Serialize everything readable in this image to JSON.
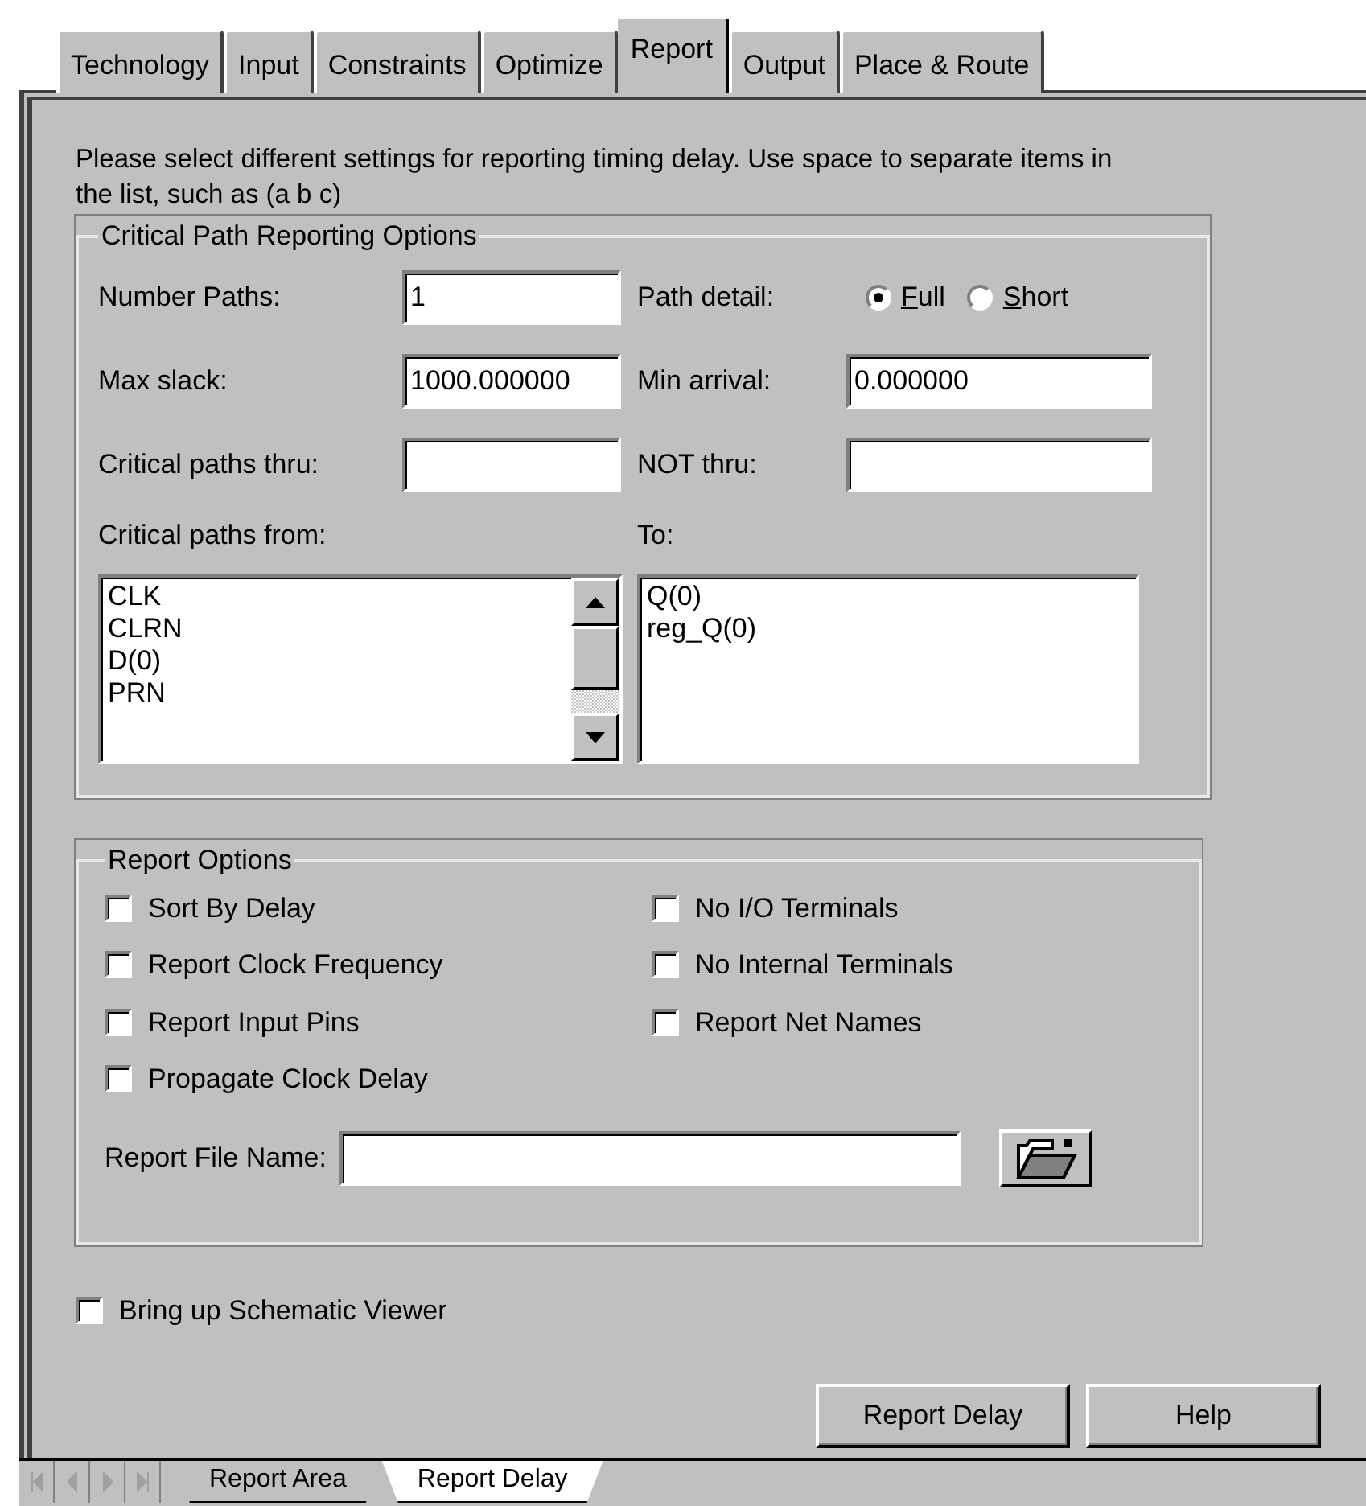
{
  "tabs": [
    {
      "label": "Technology",
      "selected": false
    },
    {
      "label": "Input",
      "selected": false
    },
    {
      "label": "Constraints",
      "selected": false
    },
    {
      "label": "Optimize",
      "selected": false
    },
    {
      "label": "Report",
      "selected": true
    },
    {
      "label": "Output",
      "selected": false
    },
    {
      "label": "Place & Route",
      "selected": false
    }
  ],
  "intro": "Please select different settings for reporting timing delay.  Use space to separate items in the list, such as (a b c)",
  "critical_path": {
    "title": "Critical Path Reporting Options",
    "number_paths": {
      "label": "Number Paths:",
      "value": "1"
    },
    "path_detail": {
      "label": "Path detail:",
      "options": [
        {
          "label": "Full",
          "selected": true
        },
        {
          "label": "Short",
          "selected": false
        }
      ]
    },
    "max_slack": {
      "label": "Max slack:",
      "value": "1000.000000"
    },
    "min_arrival": {
      "label": "Min arrival:",
      "value": "0.000000"
    },
    "thru": {
      "label": "Critical paths thru:"
    },
    "not_thru": {
      "label": "NOT thru:"
    },
    "from": {
      "label": "Critical paths from:",
      "items": [
        "CLK",
        "CLRN",
        "D(0)",
        "PRN"
      ]
    },
    "to": {
      "label": "To:",
      "items": [
        "Q(0)",
        "reg_Q(0)"
      ]
    }
  },
  "report_options": {
    "title": "Report Options",
    "left": [
      {
        "label": "Sort By Delay",
        "checked": false
      },
      {
        "label": "Report Clock Frequency",
        "checked": false
      },
      {
        "label": "Report Input Pins",
        "checked": false
      },
      {
        "label": "Propagate Clock Delay",
        "checked": false
      }
    ],
    "right": [
      {
        "label": "No I/O Terminals",
        "checked": false
      },
      {
        "label": "No Internal Terminals",
        "checked": false
      },
      {
        "label": "Report Net Names",
        "checked": false
      }
    ],
    "file": {
      "label": "Report File Name:"
    }
  },
  "schematic": {
    "label": "Bring up Schematic Viewer",
    "checked": false
  },
  "buttons": [
    "Report Delay",
    "Help"
  ],
  "sheet_tabs": [
    {
      "label": "Report Area",
      "selected": false
    },
    {
      "label": "Report Delay",
      "selected": true
    }
  ]
}
